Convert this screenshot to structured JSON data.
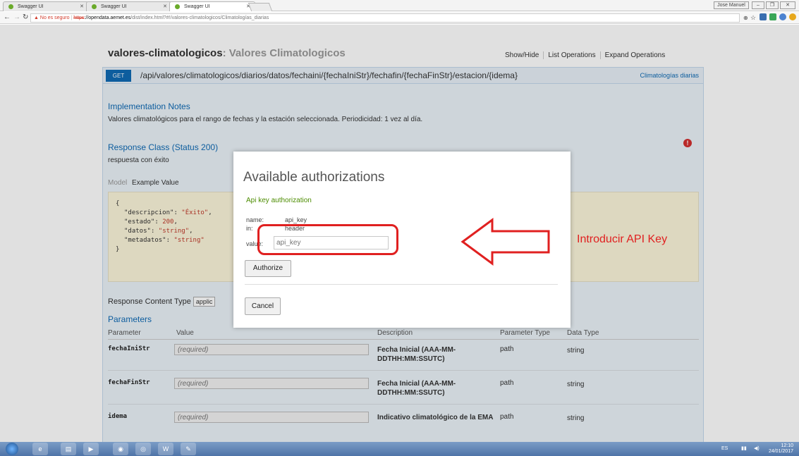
{
  "browser": {
    "tabs": [
      {
        "title": "Swagger UI"
      },
      {
        "title": "Swagger UI"
      },
      {
        "title": "Swagger UI"
      }
    ],
    "window_user": "Jose Manuel",
    "address": {
      "security_label": "No es seguro",
      "scheme": "https",
      "host": "://opendata.aemet.es",
      "path": "/dist/index.html?#!/valores-climatologicos/Climatologías_diarias"
    }
  },
  "api": {
    "resource_name": "valores-climatologicos",
    "resource_desc": ": Valores Climatologicos",
    "nav": [
      "Show/Hide",
      "List Operations",
      "Expand Operations"
    ],
    "operation": {
      "method": "GET",
      "path": "/api/valores/climatologicos/diarios/datos/fechaini/{fechaIniStr}/fechafin/{fechaFinStr}/estacion/{idema}",
      "summary": "Climatologías diarias"
    },
    "implementation_notes_title": "Implementation Notes",
    "implementation_notes": "Valores climatológicos para el rango de fechas y la estación seleccionada. Periodicidad: 1 vez al día.",
    "response_class_title": "Response Class (Status 200)",
    "response_class_desc": "respuesta con éxito",
    "model_tab": "Model",
    "example_tab": "Example Value",
    "example": {
      "open": "{",
      "lines": [
        {
          "key": "\"descripcion\"",
          "value": "\"Éxito\"",
          "sep": ","
        },
        {
          "key": "\"estado\"",
          "value": "200",
          "sep": ","
        },
        {
          "key": "\"datos\"",
          "value": "\"string\"",
          "sep": ","
        },
        {
          "key": "\"metadatos\"",
          "value": "\"string\"",
          "sep": ""
        }
      ],
      "close": "}"
    },
    "response_content_type_label": "Response Content Type",
    "response_content_type_value": "applic",
    "parameters_title": "Parameters",
    "param_headers": {
      "parameter": "Parameter",
      "value": "Value",
      "description": "Description",
      "parameter_type": "Parameter Type",
      "data_type": "Data Type"
    },
    "params": [
      {
        "name": "fechaIniStr",
        "placeholder": "(required)",
        "description": "Fecha Inicial (AAA-MM-DDTHH:MM:SSUTC)",
        "ptype": "path",
        "dtype": "string"
      },
      {
        "name": "fechaFinStr",
        "placeholder": "(required)",
        "description": "Fecha Inicial (AAA-MM-DDTHH:MM:SSUTC)",
        "ptype": "path",
        "dtype": "string"
      },
      {
        "name": "idema",
        "placeholder": "(required)",
        "description": "Indicativo climatológico de la EMA",
        "ptype": "path",
        "dtype": "string"
      }
    ]
  },
  "modal": {
    "title": "Available authorizations",
    "auth_heading": "Api key authorization",
    "name_label": "name:",
    "name_value": "api_key",
    "in_label": "in:",
    "in_value": "header",
    "value_label": "value:",
    "input_placeholder": "api_key",
    "authorize_label": "Authorize",
    "cancel_label": "Cancel"
  },
  "annotation": {
    "text": "Introducir API Key",
    "color": "#e02020"
  },
  "taskbar": {
    "lang": "ES",
    "time": "12:10",
    "date": "24/01/2017"
  },
  "colors": {
    "get_badge": "#0f6ab4",
    "op_bar": "#e7f0f7",
    "auth_heading": "#4c8c00",
    "error_icon": "#d32f2f"
  }
}
